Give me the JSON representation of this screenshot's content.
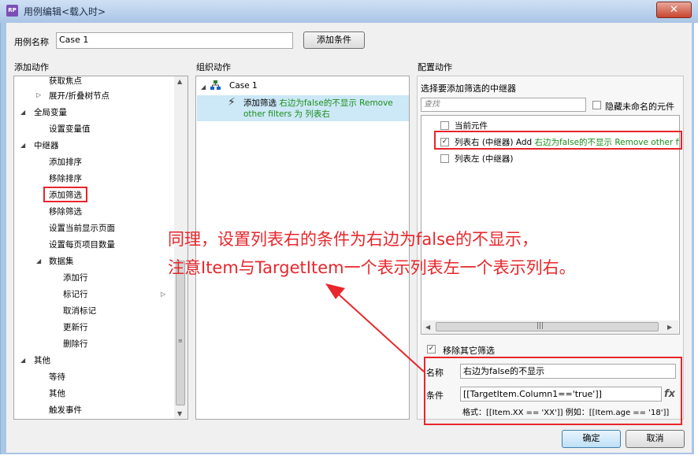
{
  "window": {
    "title": "用例编辑<载入时>",
    "app_icon": "RP",
    "close_glyph": "✕"
  },
  "case_name": {
    "label": "用例名称",
    "value": "Case 1",
    "add_condition": "添加条件"
  },
  "left": {
    "header": "添加动作",
    "items": [
      "获取焦点",
      "展开/折叠树节点",
      "全局变量",
      "设置变量值",
      "中继器",
      "添加排序",
      "移除排序",
      "添加筛选",
      "移除筛选",
      "设置当前显示页面",
      "设置每页项目数量",
      "数据集",
      "添加行",
      "标记行",
      "取消标记",
      "更新行",
      "删除行",
      "其他",
      "等待",
      "其他",
      "触发事件"
    ]
  },
  "middle": {
    "header": "组织动作",
    "case_label": "Case 1",
    "action_prefix": "添加筛选",
    "action_green": "右边为false的不显示 Remove other filters 为 列表右"
  },
  "right": {
    "header": "配置动作",
    "select_label": "选择要添加筛选的中继器",
    "search_placeholder": "查找",
    "hide_unnamed": "隐藏未命名的元件",
    "list": {
      "current": "当前元件",
      "right_prefix": "列表右 (中继器) Add",
      "right_green": "右边为false的不显示 Remove other fil",
      "left_item": "列表左 (中继器)"
    },
    "remove_others": "移除其它筛选",
    "name_label": "名称",
    "name_value": "右边为false的不显示",
    "cond_label": "条件",
    "cond_value": "[[TargetItem.Column1=='true']]",
    "fx": "fx",
    "format_hint": "格式：[[Item.XX == 'XX']] 例如：[[Item.age == '18']]"
  },
  "annotation": {
    "line1": "同理，设置列表右的条件为右边为false的不显示，",
    "line2": "注意Item与TargetItem一个表示列表左一个表示列右。",
    "color": "#e8262b"
  },
  "footer": {
    "ok": "确定",
    "cancel": "取消"
  }
}
